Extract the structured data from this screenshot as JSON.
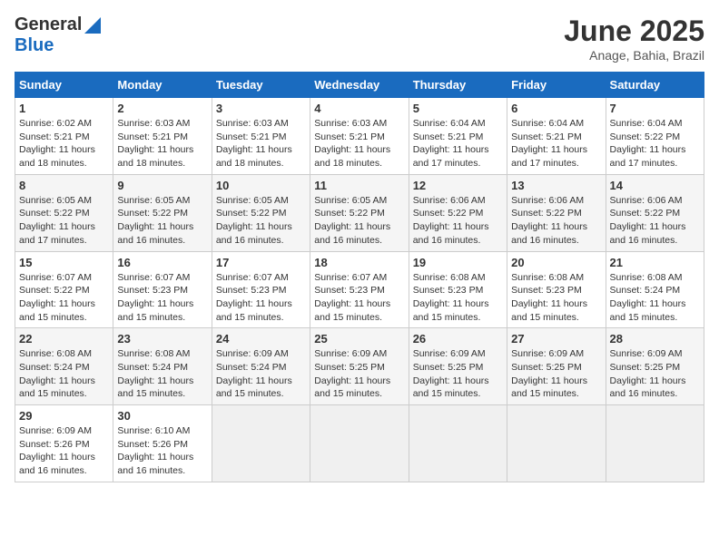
{
  "header": {
    "logo_general": "General",
    "logo_blue": "Blue",
    "month_title": "June 2025",
    "location": "Anage, Bahia, Brazil"
  },
  "calendar": {
    "days_of_week": [
      "Sunday",
      "Monday",
      "Tuesday",
      "Wednesday",
      "Thursday",
      "Friday",
      "Saturday"
    ],
    "weeks": [
      [
        null,
        {
          "day": "2",
          "sunrise": "6:03 AM",
          "sunset": "5:21 PM",
          "daylight": "11 hours and 18 minutes."
        },
        {
          "day": "3",
          "sunrise": "6:03 AM",
          "sunset": "5:21 PM",
          "daylight": "11 hours and 18 minutes."
        },
        {
          "day": "4",
          "sunrise": "6:03 AM",
          "sunset": "5:21 PM",
          "daylight": "11 hours and 18 minutes."
        },
        {
          "day": "5",
          "sunrise": "6:04 AM",
          "sunset": "5:21 PM",
          "daylight": "11 hours and 17 minutes."
        },
        {
          "day": "6",
          "sunrise": "6:04 AM",
          "sunset": "5:21 PM",
          "daylight": "11 hours and 17 minutes."
        },
        {
          "day": "7",
          "sunrise": "6:04 AM",
          "sunset": "5:22 PM",
          "daylight": "11 hours and 17 minutes."
        }
      ],
      [
        {
          "day": "1",
          "sunrise": "6:02 AM",
          "sunset": "5:21 PM",
          "daylight": "11 hours and 18 minutes."
        },
        {
          "day": "8",
          "sunrise": "6:05 AM",
          "sunset": "5:22 PM",
          "daylight": "11 hours and 17 minutes."
        },
        {
          "day": "9",
          "sunrise": "6:05 AM",
          "sunset": "5:22 PM",
          "daylight": "11 hours and 16 minutes."
        },
        {
          "day": "10",
          "sunrise": "6:05 AM",
          "sunset": "5:22 PM",
          "daylight": "11 hours and 16 minutes."
        },
        {
          "day": "11",
          "sunrise": "6:05 AM",
          "sunset": "5:22 PM",
          "daylight": "11 hours and 16 minutes."
        },
        {
          "day": "12",
          "sunrise": "6:06 AM",
          "sunset": "5:22 PM",
          "daylight": "11 hours and 16 minutes."
        },
        {
          "day": "13",
          "sunrise": "6:06 AM",
          "sunset": "5:22 PM",
          "daylight": "11 hours and 16 minutes."
        }
      ],
      [
        {
          "day": "14",
          "sunrise": "6:06 AM",
          "sunset": "5:22 PM",
          "daylight": "11 hours and 16 minutes."
        },
        {
          "day": "15",
          "sunrise": "6:07 AM",
          "sunset": "5:22 PM",
          "daylight": "11 hours and 15 minutes."
        },
        {
          "day": "16",
          "sunrise": "6:07 AM",
          "sunset": "5:23 PM",
          "daylight": "11 hours and 15 minutes."
        },
        {
          "day": "17",
          "sunrise": "6:07 AM",
          "sunset": "5:23 PM",
          "daylight": "11 hours and 15 minutes."
        },
        {
          "day": "18",
          "sunrise": "6:07 AM",
          "sunset": "5:23 PM",
          "daylight": "11 hours and 15 minutes."
        },
        {
          "day": "19",
          "sunrise": "6:08 AM",
          "sunset": "5:23 PM",
          "daylight": "11 hours and 15 minutes."
        },
        {
          "day": "20",
          "sunrise": "6:08 AM",
          "sunset": "5:23 PM",
          "daylight": "11 hours and 15 minutes."
        }
      ],
      [
        {
          "day": "21",
          "sunrise": "6:08 AM",
          "sunset": "5:24 PM",
          "daylight": "11 hours and 15 minutes."
        },
        {
          "day": "22",
          "sunrise": "6:08 AM",
          "sunset": "5:24 PM",
          "daylight": "11 hours and 15 minutes."
        },
        {
          "day": "23",
          "sunrise": "6:08 AM",
          "sunset": "5:24 PM",
          "daylight": "11 hours and 15 minutes."
        },
        {
          "day": "24",
          "sunrise": "6:09 AM",
          "sunset": "5:24 PM",
          "daylight": "11 hours and 15 minutes."
        },
        {
          "day": "25",
          "sunrise": "6:09 AM",
          "sunset": "5:25 PM",
          "daylight": "11 hours and 15 minutes."
        },
        {
          "day": "26",
          "sunrise": "6:09 AM",
          "sunset": "5:25 PM",
          "daylight": "11 hours and 15 minutes."
        },
        {
          "day": "27",
          "sunrise": "6:09 AM",
          "sunset": "5:25 PM",
          "daylight": "11 hours and 15 minutes."
        }
      ],
      [
        {
          "day": "28",
          "sunrise": "6:09 AM",
          "sunset": "5:25 PM",
          "daylight": "11 hours and 16 minutes."
        },
        {
          "day": "29",
          "sunrise": "6:09 AM",
          "sunset": "5:26 PM",
          "daylight": "11 hours and 16 minutes."
        },
        {
          "day": "30",
          "sunrise": "6:10 AM",
          "sunset": "5:26 PM",
          "daylight": "11 hours and 16 minutes."
        },
        null,
        null,
        null,
        null
      ]
    ]
  }
}
